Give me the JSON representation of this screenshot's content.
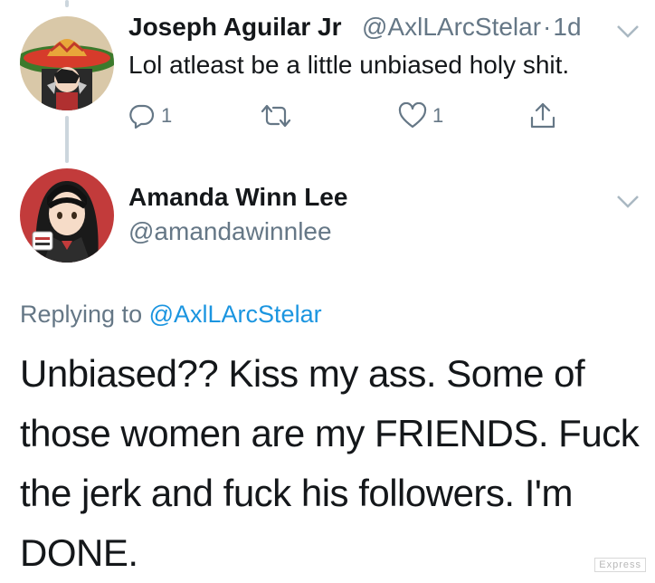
{
  "tweet1": {
    "display_name": "Joseph Aguilar Jr",
    "handle": "@AxlLArcStelar",
    "separator": "·",
    "time": "1d",
    "text": "Lol atleast be a little unbiased holy shit.",
    "actions": {
      "reply_count": "1",
      "retweet_count": "",
      "like_count": "1"
    }
  },
  "tweet2": {
    "display_name": "Amanda Winn Lee",
    "handle": "@amandawinnlee",
    "replying_prefix": "Replying to",
    "replying_to": "@AxlLArcStelar",
    "text": "Unbiased?? Kiss my ass. Some of those women are my FRIENDS. Fuck the jerk and fuck his followers. I'm DONE."
  },
  "watermark": "Express",
  "icons": {
    "reply": "reply-icon",
    "retweet": "retweet-icon",
    "like": "like-icon",
    "share": "share-icon",
    "menu": "chevron-down-icon"
  },
  "colors": {
    "text": "#14171a",
    "secondary": "#657786",
    "link": "#1b95e0",
    "thread_line": "#ccd6dd"
  }
}
